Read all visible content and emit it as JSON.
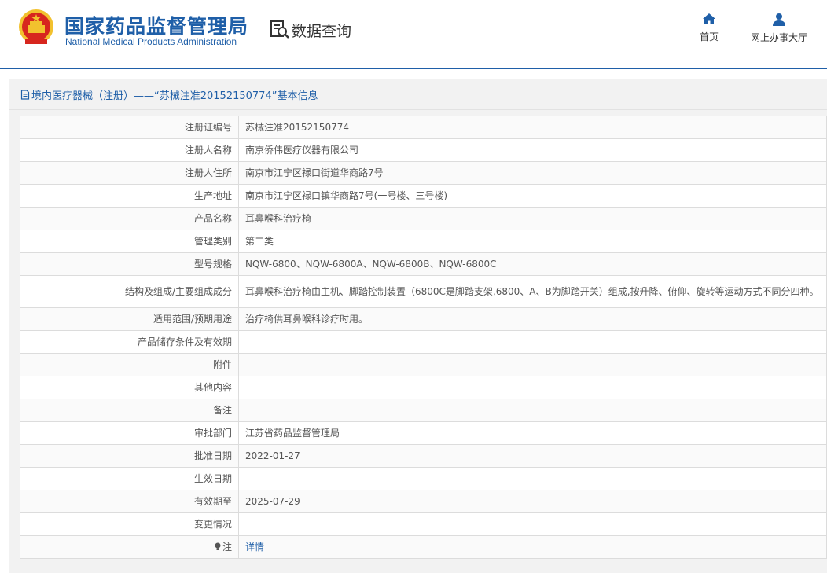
{
  "header": {
    "brand_cn": "国家药品监督管理局",
    "brand_en": "National Medical Products Administration",
    "query_title": "数据查询",
    "nav": {
      "home": "首页",
      "hall": "网上办事大厅"
    },
    "colors": {
      "brand": "#1f5fa8",
      "emblem_red": "#d7261e",
      "emblem_gold": "#f2c12e"
    }
  },
  "panel": {
    "title": "境内医疗器械（注册）——“苏械注准20152150774”基本信息",
    "title_icon": "document-icon"
  },
  "rows": [
    {
      "key": "注册证编号",
      "value": "苏械注准20152150774"
    },
    {
      "key": "注册人名称",
      "value": "南京侨伟医疗仪器有限公司"
    },
    {
      "key": "注册人住所",
      "value": "南京市江宁区禄口街道华商路7号"
    },
    {
      "key": "生产地址",
      "value": "南京市江宁区禄口镇华商路7号(一号楼、三号楼)"
    },
    {
      "key": "产品名称",
      "value": "耳鼻喉科治疗椅"
    },
    {
      "key": "管理类别",
      "value": "第二类"
    },
    {
      "key": "型号规格",
      "value": "NQW-6800、NQW-6800A、NQW-6800B、NQW-6800C"
    },
    {
      "key": "结构及组成/主要组成成分",
      "value": "耳鼻喉科治疗椅由主机、脚踏控制装置（6800C是脚踏支架,6800、A、B为脚踏开关）组成,按升降、俯仰、旋转等运动方式不同分四种。"
    },
    {
      "key": "适用范围/预期用途",
      "value": "治疗椅供耳鼻喉科诊疗时用。"
    },
    {
      "key": "产品储存条件及有效期",
      "value": ""
    },
    {
      "key": "附件",
      "value": ""
    },
    {
      "key": "其他内容",
      "value": ""
    },
    {
      "key": "备注",
      "value": ""
    },
    {
      "key": "审批部门",
      "value": "江苏省药品监督管理局"
    },
    {
      "key": "批准日期",
      "value": "2022-01-27"
    },
    {
      "key": "生效日期",
      "value": ""
    },
    {
      "key": "有效期至",
      "value": "2025-07-29"
    },
    {
      "key": "变更情况",
      "value": ""
    }
  ],
  "note": {
    "key": "注",
    "icon": "lightbulb-icon",
    "link": "详情"
  }
}
